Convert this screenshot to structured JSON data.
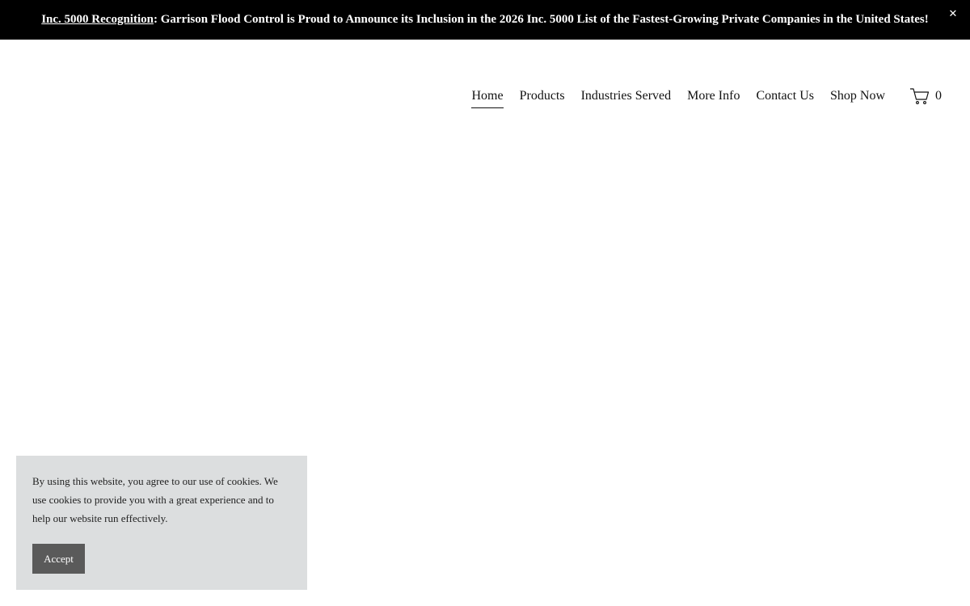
{
  "announcement": {
    "link_text": "Inc. 5000 Recognition",
    "message": ": Garrison Flood Control is Proud to Announce its Inclusion in the 2026 Inc. 5000 List of the Fastest-Growing Private Companies in the United States!",
    "close_glyph": "✕",
    "background": "#000000",
    "text_color": "#ffffff"
  },
  "nav": {
    "items": [
      {
        "label": "Home",
        "active": true
      },
      {
        "label": "Products"
      },
      {
        "label": "Industries Served"
      },
      {
        "label": "More Info"
      },
      {
        "label": "Contact Us"
      },
      {
        "label": "Shop Now"
      }
    ]
  },
  "cart": {
    "icon": "cart-icon",
    "count": "0"
  },
  "cookie_banner": {
    "text": "By using this website, you agree to our use of cookies. We use cookies to provide you with a great experience and to help our website run effectively.",
    "accept_label": "Accept",
    "background": "#dcdedf",
    "button_color": "#5a5a5a"
  }
}
